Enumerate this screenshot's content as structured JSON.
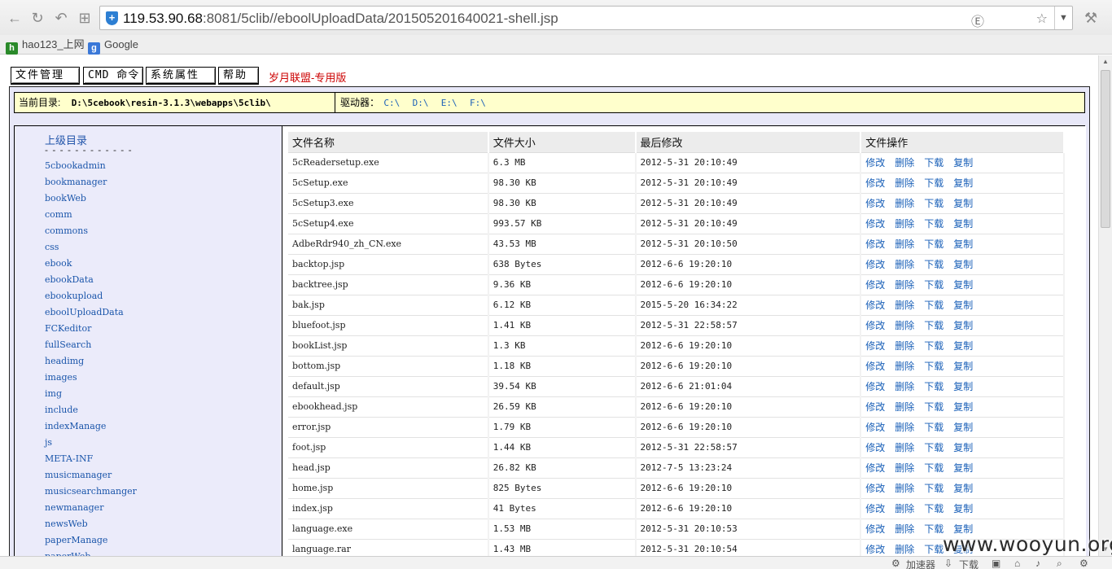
{
  "browser": {
    "url_host": "119.53.90.68",
    "url_rest": ":8081/5clib//eboolUploadData/201505201640021-shell.jsp",
    "bookmarks": [
      {
        "label": "hao123_上网"
      },
      {
        "label": "Google"
      }
    ]
  },
  "menu": {
    "file_manage": "文件管理",
    "cmd": "CMD 命令",
    "sys_props": "系统属性",
    "help": "帮助",
    "brand": "岁月联盟-专用版"
  },
  "dirbar": {
    "current_label": "当前目录:",
    "current_path": "D:\\5cebook\\resin-3.1.3\\webapps\\5clib\\",
    "drives_label": "驱动器：",
    "drives": [
      "C:\\",
      "D:\\",
      "E:\\",
      "F:\\"
    ]
  },
  "sidebar": {
    "parent_label": "上级目录",
    "dash": "- - - - - - - - - - - -",
    "dirs": [
      "5cbookadmin",
      "bookmanager",
      "bookWeb",
      "comm",
      "commons",
      "css",
      "ebook",
      "ebookData",
      "ebookupload",
      "eboolUploadData",
      "FCKeditor",
      "fullSearch",
      "headimg",
      "images",
      "img",
      "include",
      "indexManage",
      "js",
      "META-INF",
      "musicmanager",
      "musicsearchmanger",
      "newmanager",
      "newsWeb",
      "paperManage",
      "paperWeb"
    ]
  },
  "table": {
    "headers": [
      "文件名称",
      "文件大小",
      "最后修改",
      "文件操作"
    ],
    "actions": [
      "修改",
      "删除",
      "下载",
      "复制"
    ],
    "rows": [
      [
        "5cReadersetup.exe",
        "6.3 MB",
        "2012-5-31 20:10:49"
      ],
      [
        "5cSetup.exe",
        "98.30 KB",
        "2012-5-31 20:10:49"
      ],
      [
        "5cSetup3.exe",
        "98.30 KB",
        "2012-5-31 20:10:49"
      ],
      [
        "5cSetup4.exe",
        "993.57 KB",
        "2012-5-31 20:10:49"
      ],
      [
        "AdbeRdr940_zh_CN.exe",
        "43.53 MB",
        "2012-5-31 20:10:50"
      ],
      [
        "backtop.jsp",
        "638 Bytes",
        "2012-6-6 19:20:10"
      ],
      [
        "backtree.jsp",
        "9.36 KB",
        "2012-6-6 19:20:10"
      ],
      [
        "bak.jsp",
        "6.12 KB",
        "2015-5-20 16:34:22"
      ],
      [
        "bluefoot.jsp",
        "1.41 KB",
        "2012-5-31 22:58:57"
      ],
      [
        "bookList.jsp",
        "1.3 KB",
        "2012-6-6 19:20:10"
      ],
      [
        "bottom.jsp",
        "1.18 KB",
        "2012-6-6 19:20:10"
      ],
      [
        "default.jsp",
        "39.54 KB",
        "2012-6-6 21:01:04"
      ],
      [
        "ebookhead.jsp",
        "26.59 KB",
        "2012-6-6 19:20:10"
      ],
      [
        "error.jsp",
        "1.79 KB",
        "2012-6-6 19:20:10"
      ],
      [
        "foot.jsp",
        "1.44 KB",
        "2012-5-31 22:58:57"
      ],
      [
        "head.jsp",
        "26.82 KB",
        "2012-7-5 13:23:24"
      ],
      [
        "home.jsp",
        "825 Bytes",
        "2012-6-6 19:20:10"
      ],
      [
        "index.jsp",
        "41 Bytes",
        "2012-6-6 19:20:10"
      ],
      [
        "language.exe",
        "1.53 MB",
        "2012-5-31 20:10:53"
      ],
      [
        "language.rar",
        "1.43 MB",
        "2012-5-31 20:10:54"
      ]
    ]
  },
  "statusbar": {
    "accelerator": "加速器",
    "download": "下载"
  },
  "watermark": "www.wooyun.org",
  "colors": {
    "link": "#1a60b8",
    "brand": "#cc0000",
    "dirbar_bg": "#ffffcc",
    "sidebar_bg": "#ebebfa"
  }
}
